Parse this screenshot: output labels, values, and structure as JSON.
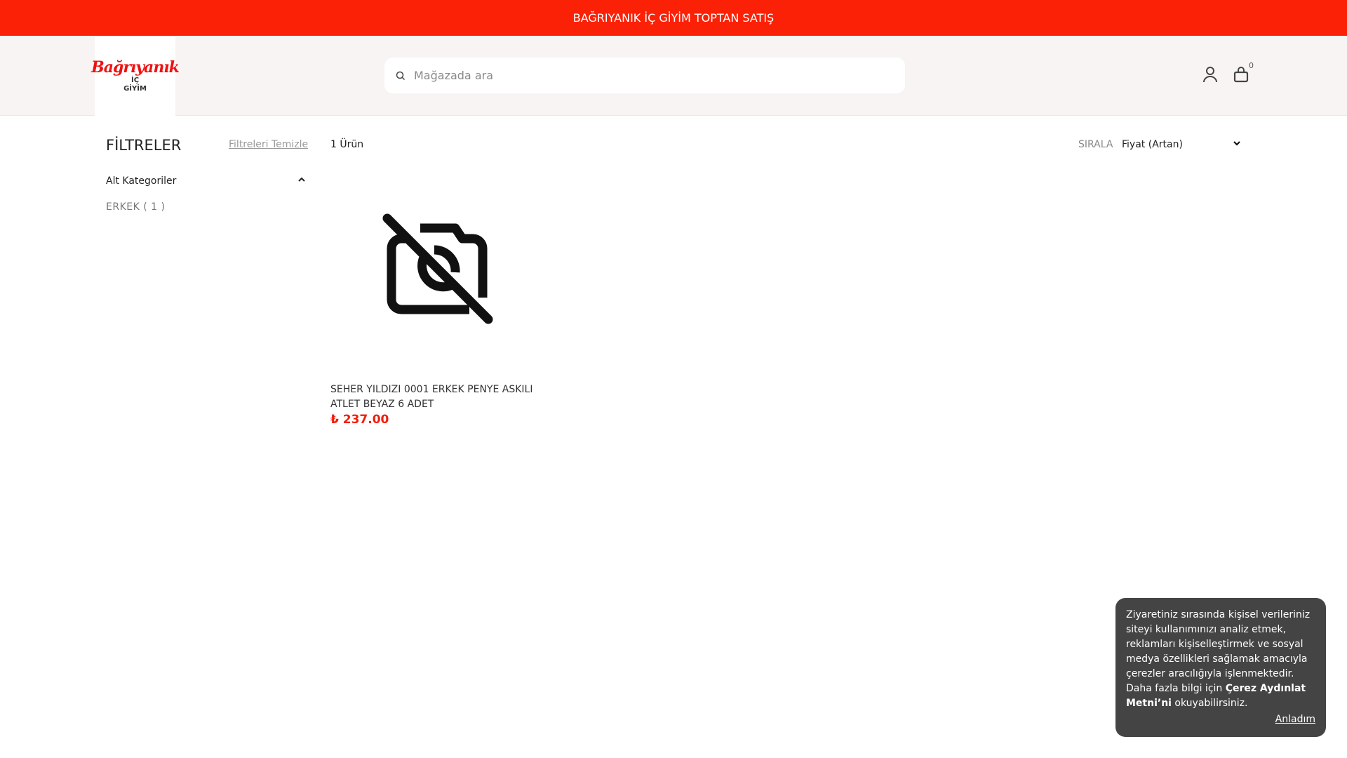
{
  "banner": "BAĞRIYANIK İÇ GİYİM TOPTAN SATIŞ",
  "logo": {
    "line1": "Bağrıyanık",
    "line2": "İÇ",
    "line3": "GİYİM"
  },
  "search": {
    "placeholder": "Mağazada ara"
  },
  "cart": {
    "count": "0"
  },
  "filters": {
    "title": "FİLTRELER",
    "clear": "Filtreleri Temizle",
    "section": "Alt Kategoriler",
    "items": [
      {
        "label": "ERKEK ( 1 )"
      }
    ]
  },
  "results": {
    "count": "1 Ürün",
    "sort_label": "SIRALA",
    "sort_value": "Fiyat (Artan)"
  },
  "products": [
    {
      "title": "SEHER YILDIZI 0001 ERKEK PENYE ASKILI ATLET BEYAZ 6 ADET",
      "price": "₺ 237.00"
    }
  ],
  "cookie": {
    "text": "Ziyaretiniz sırasında kişisel verileriniz siteyi kullanımınızı analiz etmek, reklamları kişiselleştirmek ve sosyal medya özellikleri sağlamak amacıyla çerezler aracılığıyla işlenmektedir. Daha fazla bilgi için ",
    "link": "Çerez Aydınlat Metni’ni",
    "after": " okuyabilirsiniz.",
    "ok": "Anladım"
  },
  "colors": {
    "brand": "#fb2107",
    "header_bg": "#f8f4f3"
  }
}
